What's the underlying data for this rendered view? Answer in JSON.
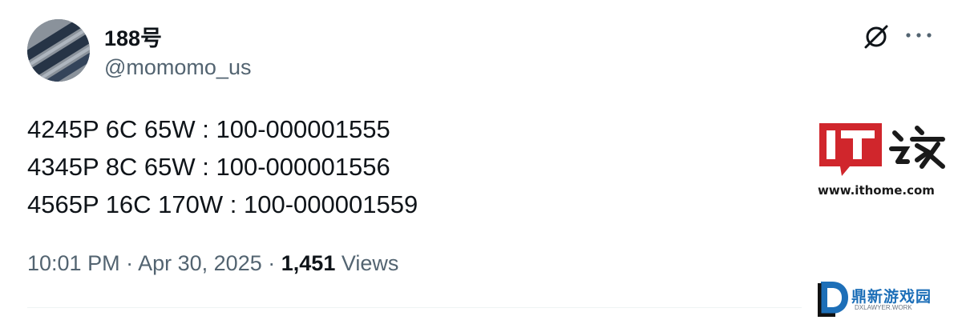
{
  "author": {
    "name": "188号",
    "handle": "@momomo_us"
  },
  "toolbar": {
    "grok_icon": "grok-icon",
    "more_icon": "more-icon"
  },
  "tweet": {
    "lines": [
      "4245P 6C 65W : 100-000001555",
      "4345P 8C 65W : 100-000001556",
      "4565P 16C 170W : 100-000001559"
    ],
    "time": "10:01 PM",
    "separator": "·",
    "date": "Apr 30, 2025",
    "views_count": "1,451",
    "views_label": "Views"
  },
  "watermarks": {
    "ithome_logo": "IT之家",
    "ithome_url": "www.ithome.com",
    "dx_title": "鼎新游戏园",
    "dx_sub": "DXLAWYER.WORK"
  },
  "colors": {
    "text_primary": "#0f1419",
    "text_secondary": "#536471",
    "ithome_red": "#d0262c",
    "dx_blue": "#1d6fb8"
  }
}
